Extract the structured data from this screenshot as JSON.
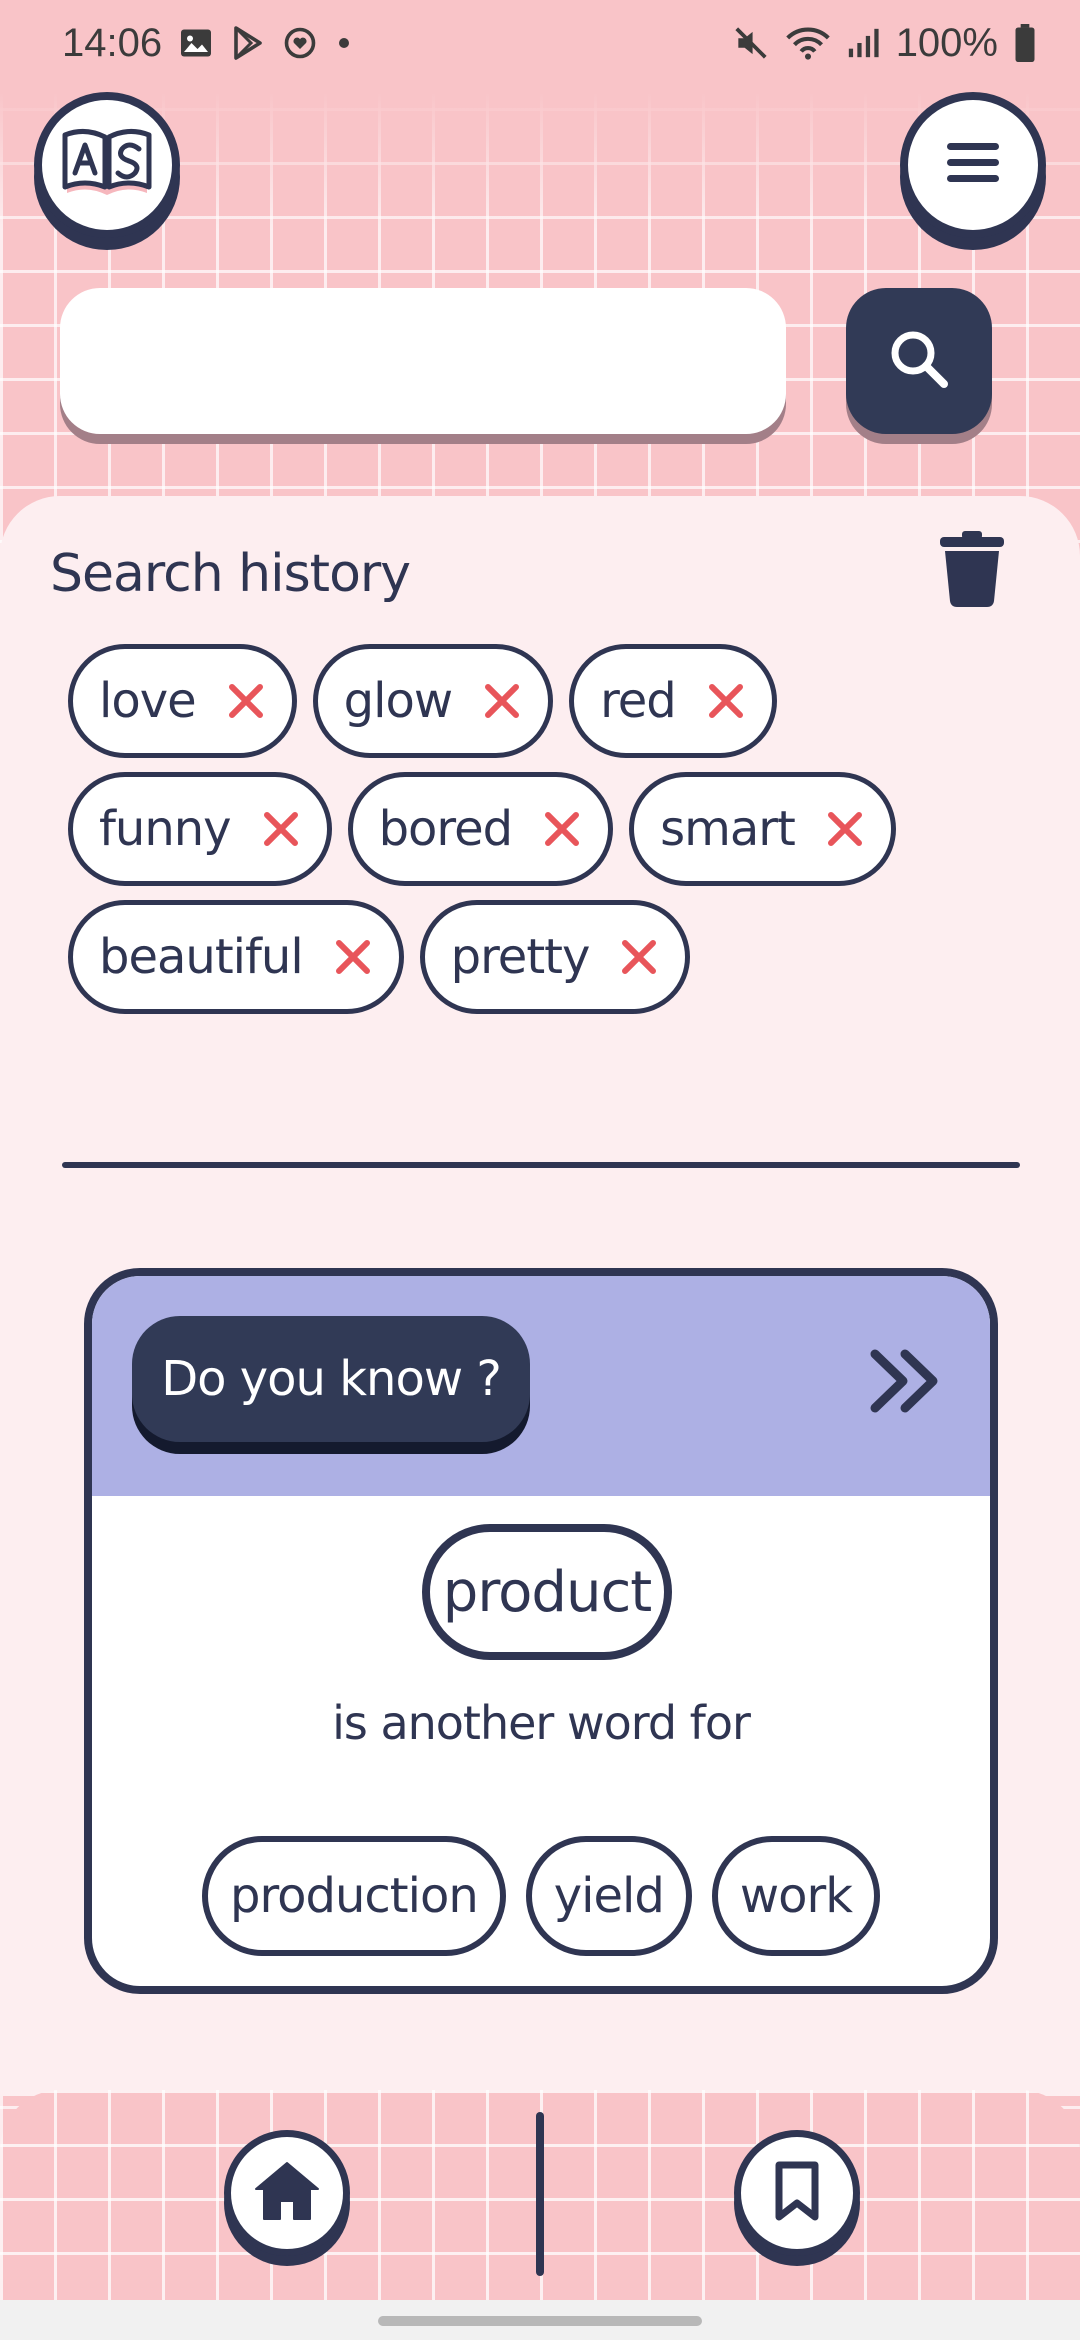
{
  "status_bar": {
    "time": "14:06",
    "battery": "100%",
    "left_icons": [
      "gallery-icon",
      "play-store-icon",
      "heart-circle-icon",
      "dot-icon"
    ],
    "right_icons": [
      "mute-icon",
      "wifi-icon",
      "signal-icon",
      "battery-icon"
    ]
  },
  "header": {
    "logo_icon": "book-as-logo",
    "menu_icon": "hamburger-menu-icon"
  },
  "search": {
    "value": "",
    "placeholder": "",
    "button_icon": "search-icon"
  },
  "history": {
    "title": "Search history",
    "clear_icon": "trash-icon",
    "items": [
      {
        "label": "love"
      },
      {
        "label": "glow"
      },
      {
        "label": "red"
      },
      {
        "label": "funny"
      },
      {
        "label": "bored"
      },
      {
        "label": "smart"
      },
      {
        "label": "beautiful"
      },
      {
        "label": "pretty"
      }
    ]
  },
  "card": {
    "header_label": "Do you know ?",
    "next_icon": "double-chevron-right-icon",
    "word": "product",
    "caption": "is another word for",
    "synonyms": [
      "production",
      "yield",
      "work"
    ]
  },
  "bottom_nav": {
    "home_icon": "home-icon",
    "bookmark_icon": "bookmark-icon"
  },
  "colors": {
    "navy": "#2f3552",
    "pink": "#f9c4c8",
    "panel": "#fdeef0",
    "lavender": "#adb0e4",
    "remove_red": "#e8555a"
  }
}
